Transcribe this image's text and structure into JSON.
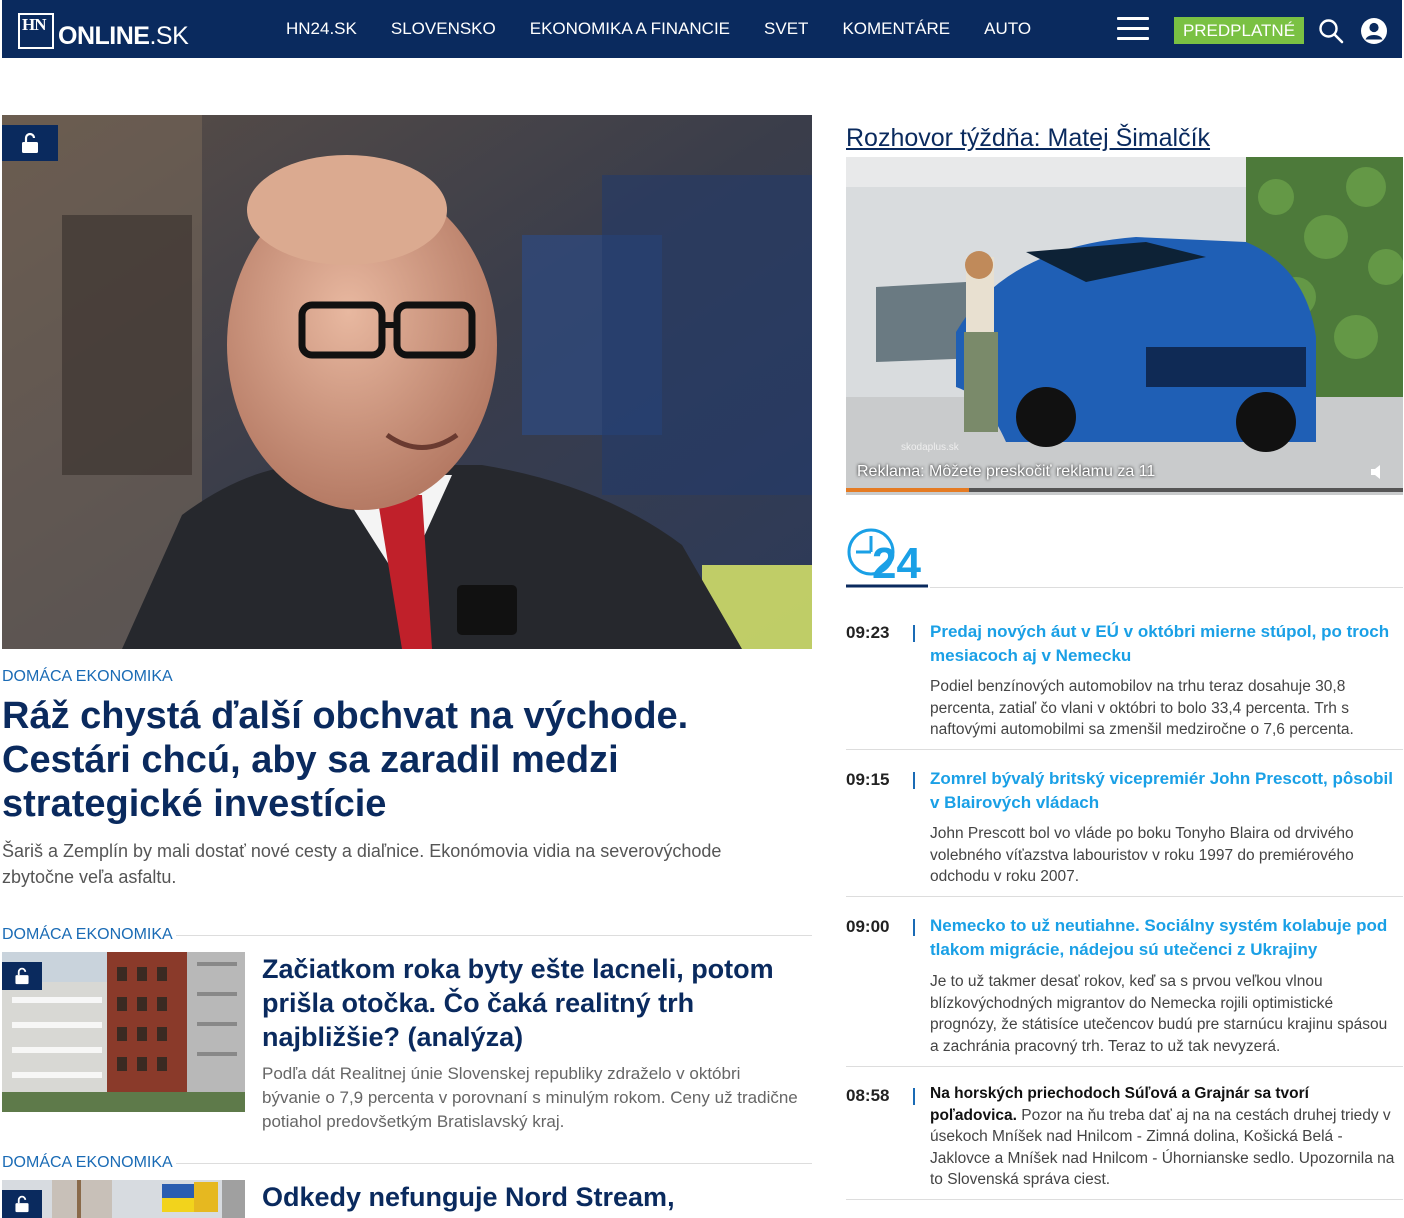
{
  "header": {
    "logo_hn": "HN",
    "logo_online": "ONLINE",
    "logo_sk": ".SK",
    "nav": [
      "HN24.SK",
      "SLOVENSKO",
      "EKONOMIKA A FINANCIE",
      "SVET",
      "KOMENTÁRE",
      "AUTO"
    ],
    "subscribe": "PREDPLATNÉ"
  },
  "hero": {
    "category": "DOMÁCA EKONOMIKA",
    "title": "Ráž chystá ďalší obchvat na východe. Cestári chcú, aby sa zaradil medzi strategické investície",
    "perex": "Šariš a Zemplín by mali dostať nové cesty a diaľnice. Ekonómovia vidia na severovýchode zbytočne veľa asfaltu."
  },
  "articles": [
    {
      "category": "DOMÁCA EKONOMIKA",
      "title": "Začiatkom roka byty ešte lacneli, potom prišla otočka. Čo čaká realitný trh najbližšie? (analýza)",
      "perex": "Podľa dát Realitnej únie Slovenskej republiky zdraželo v októbri bývanie o 7,9 percenta v porovnaní s minulým rokom. Ceny už tradične potiahol predovšetkým Bratislavský kraj."
    },
    {
      "category": "DOMÁCA EKONOMIKA",
      "title": "Odkedy nefunguje Nord Stream,"
    }
  ],
  "sidebar": {
    "interview_title": "Rozhovor týždňa: Matej Šimalčík",
    "video": {
      "ad_text": "Reklama: Môžete preskočiť reklamu za 11",
      "watermark": "skodaplus.sk",
      "progress": 0.22
    },
    "news": [
      {
        "time": "09:23",
        "title": "Predaj nových áut v EÚ v októbri mierne stúpol, po troch mesiacoch aj v Nemecku",
        "text": "Podiel benzínových automobilov na trhu teraz dosahuje 30,8 percenta, zatiaľ čo vlani v októbri to bolo 33,4 percenta. Trh s naftovými automobilmi sa zmenšil medziročne o 7,6 percenta."
      },
      {
        "time": "09:15",
        "title": "Zomrel bývalý britský vicepremiér John Prescott, pôsobil v Blairových vládach",
        "text": "John Prescott bol vo vláde po boku Tonyho Blaira od drvivého volebného víťazstva labouristov v roku 1997 do premiérového odchodu v roku 2007."
      },
      {
        "time": "09:00",
        "title": "Nemecko to už neutiahne. Sociálny systém kolabuje pod tlakom migrácie, nádejou sú utečenci z Ukrajiny",
        "text": "Je to už takmer desať rokov, keď sa s prvou veľkou vlnou blízkovýchodných migrantov do Nemecka rojili optimistické prognózy, že státisíce utečencov budú pre starnúcu krajinu spásou a zachránia pracovný trh. Teraz to už tak nevyzerá."
      },
      {
        "time": "08:58",
        "lead": "Na horských priechodoch Súľová a Grajnár sa tvorí poľadovica.",
        "text": " Pozor na ňu treba dať aj na na cestách druhej triedy v úsekoch Mníšek nad Hnilcom - Zimná dolina, Košická Belá - Jaklovce a Mníšek nad Hnilcom - Úhornianske sedlo. Upozornila na to Slovenská správa ciest."
      }
    ]
  }
}
